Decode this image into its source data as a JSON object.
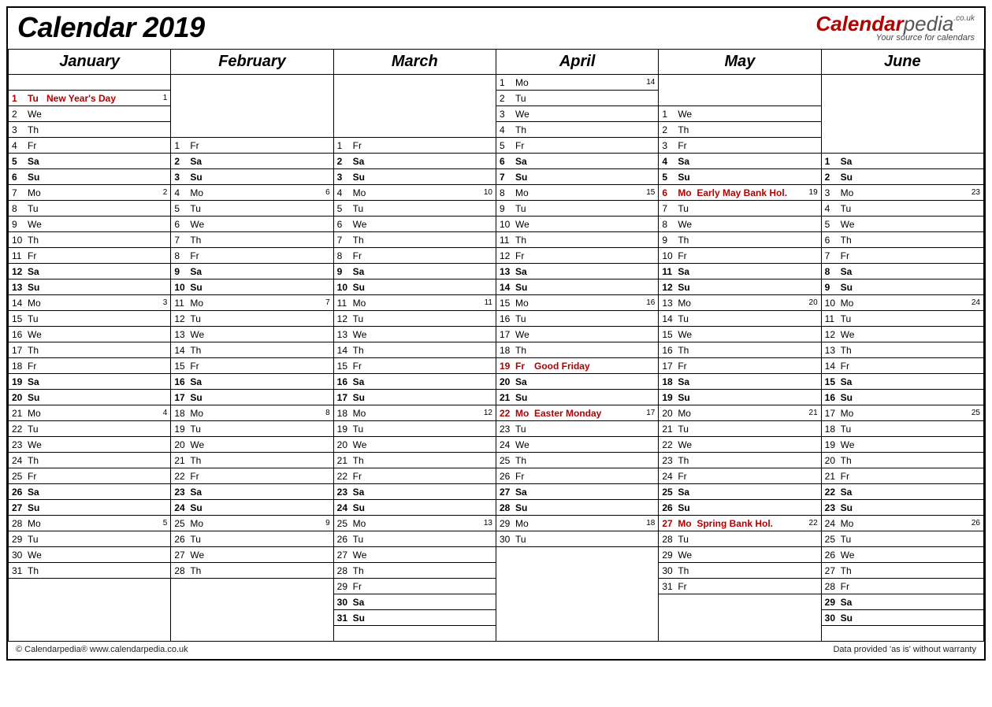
{
  "title": "Calendar 2019",
  "logo": {
    "part1": "Calendar",
    "part2": "pedia",
    "tld": ".co.uk",
    "tagline": "Your source for calendars"
  },
  "footer_left": "© Calendarpedia®   www.calendarpedia.co.uk",
  "footer_right": "Data provided 'as is' without warranty",
  "months": [
    "January",
    "February",
    "March",
    "April",
    "May",
    "June"
  ],
  "rows": 37,
  "startRow": {
    "January": 1,
    "February": 4,
    "March": 4,
    "April": 0,
    "May": 2,
    "June": 5
  },
  "daysIn": {
    "January": 31,
    "February": 28,
    "March": 31,
    "April": 30,
    "May": 31,
    "June": 30
  },
  "firstDow": {
    "January": 2,
    "February": 5,
    "March": 5,
    "April": 1,
    "May": 3,
    "June": 6
  },
  "dowNames": [
    "Su",
    "Mo",
    "Tu",
    "We",
    "Th",
    "Fr",
    "Sa"
  ],
  "holidays": {
    "January": {
      "1": "New Year's Day"
    },
    "April": {
      "19": "Good Friday",
      "22": "Easter Monday"
    },
    "May": {
      "6": "Early May Bank Hol.",
      "27": "Spring Bank Hol."
    }
  },
  "weekNums": {
    "January": {
      "1": 1,
      "7": 2,
      "14": 3,
      "21": 4,
      "28": 5
    },
    "February": {
      "4": 6,
      "11": 7,
      "18": 8,
      "25": 9
    },
    "March": {
      "4": 10,
      "11": 11,
      "18": 12,
      "25": 13
    },
    "April": {
      "1": 14,
      "8": 15,
      "15": 16,
      "22": 17,
      "29": 18
    },
    "May": {
      "6": 19,
      "13": 20,
      "20": 21,
      "27": 22
    },
    "June": {
      "3": 23,
      "10": 24,
      "17": 25,
      "24": 26
    }
  }
}
